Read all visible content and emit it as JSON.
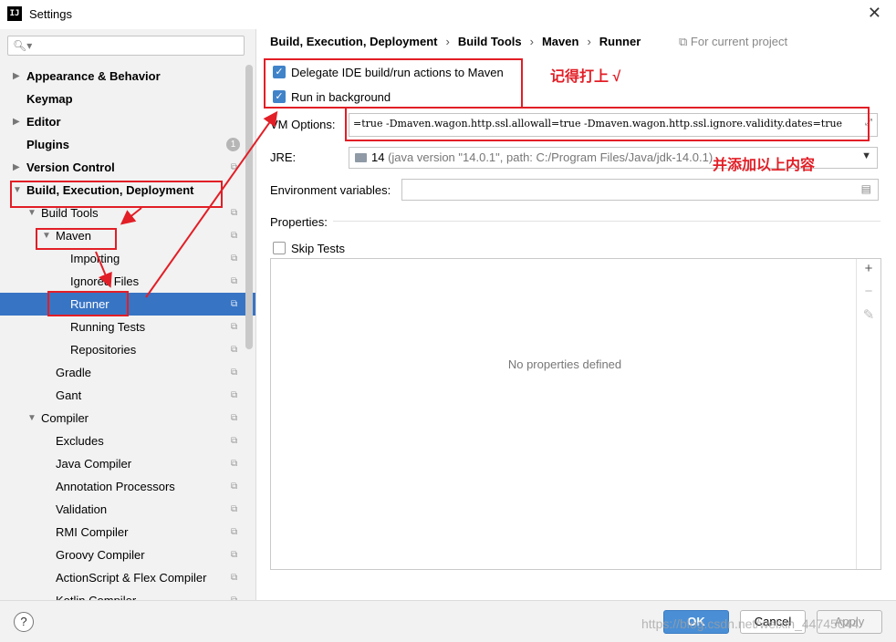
{
  "window": {
    "title": "Settings",
    "app_icon": "IJ"
  },
  "search": {
    "placeholder": ""
  },
  "tree": [
    {
      "label": "Appearance & Behavior",
      "bold": true,
      "arrow": "right",
      "icon": "",
      "indent": 0,
      "name": "appearance-behavior"
    },
    {
      "label": "Keymap",
      "bold": true,
      "arrow": "",
      "icon": "",
      "indent": 0,
      "name": "keymap"
    },
    {
      "label": "Editor",
      "bold": true,
      "arrow": "right",
      "icon": "",
      "indent": 0,
      "name": "editor"
    },
    {
      "label": "Plugins",
      "bold": true,
      "arrow": "",
      "icon": "badge",
      "badge": "1",
      "indent": 0,
      "name": "plugins"
    },
    {
      "label": "Version Control",
      "bold": true,
      "arrow": "right",
      "icon": "copy",
      "indent": 0,
      "name": "version-control"
    },
    {
      "label": "Build, Execution, Deployment",
      "bold": true,
      "arrow": "down",
      "icon": "",
      "indent": 0,
      "name": "build-execution-deployment"
    },
    {
      "label": "Build Tools",
      "bold": false,
      "arrow": "down",
      "icon": "copy",
      "indent": 1,
      "name": "build-tools"
    },
    {
      "label": "Maven",
      "bold": false,
      "arrow": "down",
      "icon": "copy",
      "indent": 2,
      "name": "maven"
    },
    {
      "label": "Importing",
      "bold": false,
      "arrow": "",
      "icon": "copy",
      "indent": 3,
      "name": "importing"
    },
    {
      "label": "Ignored Files",
      "bold": false,
      "arrow": "",
      "icon": "copy",
      "indent": 3,
      "name": "ignored-files"
    },
    {
      "label": "Runner",
      "bold": false,
      "arrow": "",
      "icon": "copy",
      "indent": 3,
      "selected": true,
      "name": "runner"
    },
    {
      "label": "Running Tests",
      "bold": false,
      "arrow": "",
      "icon": "copy",
      "indent": 3,
      "name": "running-tests"
    },
    {
      "label": "Repositories",
      "bold": false,
      "arrow": "",
      "icon": "copy",
      "indent": 3,
      "name": "repositories"
    },
    {
      "label": "Gradle",
      "bold": false,
      "arrow": "",
      "icon": "copy",
      "indent": 2,
      "name": "gradle"
    },
    {
      "label": "Gant",
      "bold": false,
      "arrow": "",
      "icon": "copy",
      "indent": 2,
      "name": "gant"
    },
    {
      "label": "Compiler",
      "bold": false,
      "arrow": "down",
      "icon": "copy",
      "indent": 1,
      "name": "compiler"
    },
    {
      "label": "Excludes",
      "bold": false,
      "arrow": "",
      "icon": "copy",
      "indent": 2,
      "name": "excludes"
    },
    {
      "label": "Java Compiler",
      "bold": false,
      "arrow": "",
      "icon": "copy",
      "indent": 2,
      "name": "java-compiler"
    },
    {
      "label": "Annotation Processors",
      "bold": false,
      "arrow": "",
      "icon": "copy",
      "indent": 2,
      "name": "annotation-processors"
    },
    {
      "label": "Validation",
      "bold": false,
      "arrow": "",
      "icon": "copy",
      "indent": 2,
      "name": "validation"
    },
    {
      "label": "RMI Compiler",
      "bold": false,
      "arrow": "",
      "icon": "copy",
      "indent": 2,
      "name": "rmi-compiler"
    },
    {
      "label": "Groovy Compiler",
      "bold": false,
      "arrow": "",
      "icon": "copy",
      "indent": 2,
      "name": "groovy-compiler"
    },
    {
      "label": "ActionScript & Flex Compiler",
      "bold": false,
      "arrow": "",
      "icon": "copy",
      "indent": 2,
      "name": "actionscript-flex-compiler"
    },
    {
      "label": "Kotlin Compiler",
      "bold": false,
      "arrow": "",
      "icon": "copy",
      "indent": 2,
      "name": "kotlin-compiler"
    }
  ],
  "breadcrumb": [
    "Build, Execution, Deployment",
    "Build Tools",
    "Maven",
    "Runner"
  ],
  "scope_label": "For current project",
  "form": {
    "delegate_label": "Delegate IDE build/run actions to Maven",
    "delegate_checked": true,
    "background_label": "Run in background",
    "background_checked": true,
    "vm_label": "VM Options:",
    "vm_value": "=true -Dmaven.wagon.http.ssl.allowall=true -Dmaven.wagon.http.ssl.ignore.validity.dates=true",
    "jre_label": "JRE:",
    "jre_version": "14",
    "jre_detail": "(java version \"14.0.1\", path: C:/Program Files/Java/jdk-14.0.1)",
    "env_label": "Environment variables:",
    "env_value": "",
    "properties_label": "Properties:",
    "skip_tests_label": "Skip Tests",
    "skip_tests_checked": false,
    "empty_properties": "No properties defined"
  },
  "buttons": {
    "ok": "OK",
    "cancel": "Cancel",
    "apply": "Apply",
    "help": "?"
  },
  "annotations": {
    "note_checked": "记得打上 √",
    "note_vm": "并添加以上内容",
    "color": "#e21e26"
  },
  "watermark": "https://blog.csdn.net/weixin_44745044",
  "colors": {
    "selection": "#3874c4",
    "checkbox": "#4083c9",
    "ok_button": "#4a8fd6"
  }
}
